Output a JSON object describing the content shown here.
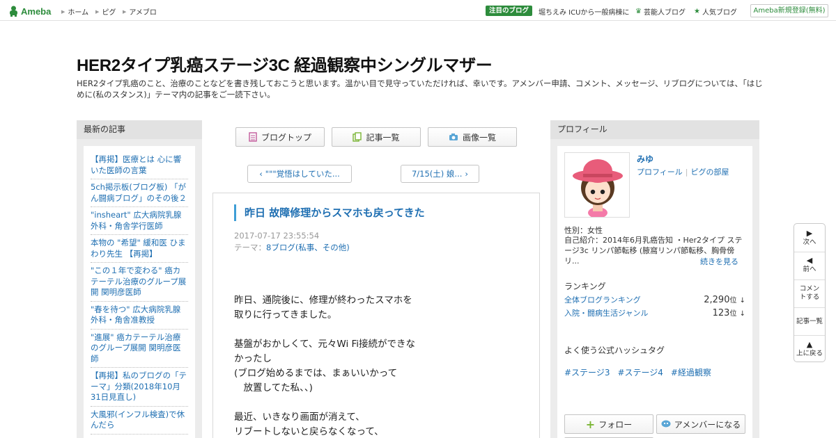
{
  "topbar": {
    "logo_text": "Ameba",
    "nav": [
      "ホーム",
      "ピグ",
      "アメブロ"
    ],
    "featured_badge": "注目のブログ",
    "featured_text": "堀ちえみ ICUから一般病棟に",
    "entertainer_blog": "芸能人ブログ",
    "popular_blog": "人気ブログ",
    "register": "Ameba新規登録(無料)"
  },
  "header": {
    "title": "HER2タイプ乳癌ステージ3C 経過観察中シングルマザー",
    "description": "HER2タイプ乳癌のこと、治療のことなどを書き残しておこうと思います。温かい目で見守っていただければ、幸いです。アメンバー申請、コメント、メッセージ、リブログについては、「はじめに(私のスタンス)」テーマ内の記事をご一読下さい。"
  },
  "left_sidebar": {
    "heading": "最新の記事",
    "items": [
      "【再掲】医療とは 心に響いた医師の言葉",
      "5ch掲示板(ブログ板) 「がん闘病ブログ」のその後２",
      "\"insheart\" 広大病院乳腺外科・角舎学行医師",
      "本物の \"希望\" 緩和医 ひまわり先生 【再掲】",
      "\"この１年で変わる\" 癌カテーテル治療のグループ展開 関明彦医師",
      "\"春を待つ\" 広大病院乳腺外科・角舎准教授",
      "\"進展\" 癌カテーテル治療のグループ展開 関明彦医師",
      "【再掲】私のブログの「テーマ」分類(2018年10月31日見直し)",
      "大風邪(インフル検査)で休んだら"
    ]
  },
  "center": {
    "tabs": {
      "blog_top": "ブログトップ",
      "entries": "記事一覧",
      "images": "画像一覧"
    },
    "pager": {
      "prev": "\"\"\"覚悟はしていた...",
      "next": "7/15(土) 娘..."
    },
    "article": {
      "title": "昨日 故障修理からスマホも戻ってきた",
      "date": "2017-07-17 23:55:54",
      "theme_label": "テーマ：",
      "theme": "8ブログ(私事、その他)",
      "paragraphs": [
        [
          "昨日、通院後に、修理が終わったスマホを",
          "取りに行ってきました。"
        ],
        [
          "基盤がおかしくて、元々Wi Fi接続ができな",
          "かったし",
          "(ブログ始めるまでは、まぁいいかって",
          "　放置してた私、、)"
        ],
        [
          "最近、いきなり画面が消えて、",
          "リブートしないと戻らなくなって、"
        ]
      ]
    }
  },
  "right_sidebar": {
    "heading": "プロフィール",
    "name": "みゆ",
    "profile_link": "プロフィール",
    "pig_link": "ピグの部屋",
    "gender": "性別：女性",
    "intro": "自己紹介：2014年6月乳癌告知 ・Her2タイプ ステージ3c リンパ節転移 (腋窩リンパ節転移、胸骨傍リ...",
    "read_more": "続きを見る",
    "ranking_label": "ランキング",
    "rankings": [
      {
        "name": "全体ブログランキング",
        "value": "2,290",
        "unit": "位",
        "arrow": "↓"
      },
      {
        "name": "入院・闘病生活ジャンル",
        "value": "123",
        "unit": "位",
        "arrow": "↓"
      }
    ],
    "hashtag_label": "よく使う公式ハッシュタグ",
    "hashtags": [
      "#ステージ3",
      "#ステージ4",
      "#経過観察"
    ],
    "follow": "フォロー",
    "amember": "アメンバーになる"
  },
  "float_nav": {
    "next": "次へ",
    "prev": "前へ",
    "comment": "コメントする",
    "entries": "記事一覧",
    "top": "上に戻る"
  },
  "colors": {
    "brand_green": "#2d8c3c",
    "link_blue": "#1f6fb2",
    "sidebar_bg": "#ececec"
  }
}
